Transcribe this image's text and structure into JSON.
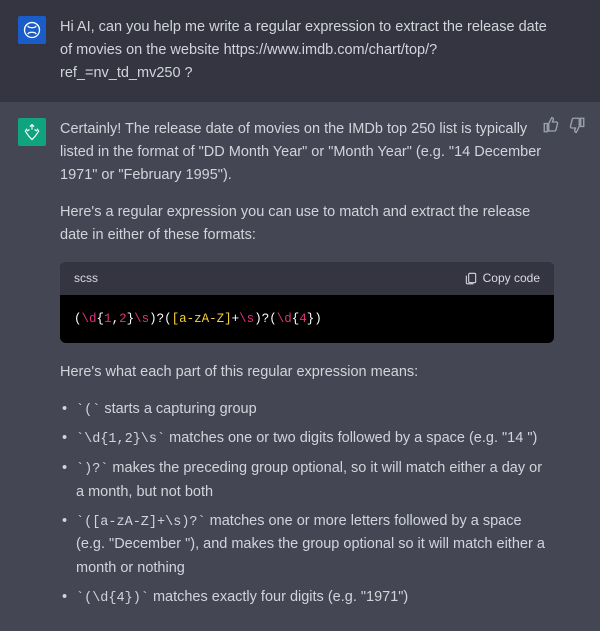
{
  "user_message": "Hi AI, can you help me write a regular expression to extract the release date of movies on the website https://www.imdb.com/chart/top/?ref_=nv_td_mv250 ?",
  "assistant": {
    "intro": "Certainly! The release date of movies on the IMDb top 250 list is typically listed in the format of \"DD Month Year\" or \"Month Year\" (e.g. \"14 December 1971\" or \"February 1995\").",
    "lead_in": "Here's a regular expression you can use to match and extract the release date in either of these formats:",
    "code_lang": "scss",
    "copy_label": "Copy code",
    "regex_plain": "(\\d{1,2}\\s)?([a-zA-Z]+\\s)?(\\d{4})",
    "explain_lead": "Here's what each part of this regular expression means:",
    "bullets": [
      {
        "code": "(",
        "text": " starts a capturing group"
      },
      {
        "code": "\\d{1,2}\\s",
        "text": " matches one or two digits followed by a space (e.g. \"14 \")"
      },
      {
        "code": ")?",
        "text": " makes the preceding group optional, so it will match either a day or a month, but not both"
      },
      {
        "code": "([a-zA-Z]+\\s)?",
        "text": " matches one or more letters followed by a space (e.g. \"December \"), and makes the group optional so it will match either a month or nothing"
      },
      {
        "code": "(\\d{4})",
        "text": " matches exactly four digits (e.g. \"1971\")"
      }
    ]
  }
}
